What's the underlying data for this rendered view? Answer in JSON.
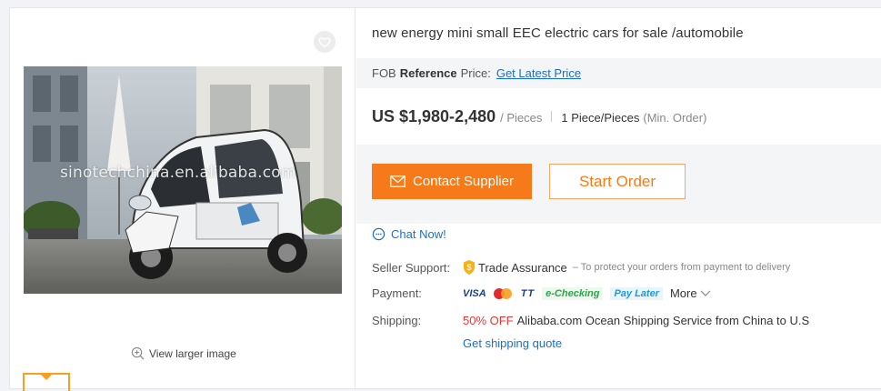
{
  "product": {
    "title": "new energy mini small EEC electric cars for sale /automobile",
    "watermark": "sinotechchina.en.alibaba.com",
    "view_larger_label": "View larger image"
  },
  "fob": {
    "prefix": "FOB",
    "bold": "Reference",
    "suffix": "Price:",
    "link": "Get Latest Price"
  },
  "price": {
    "value": "US $1,980-2,480",
    "unit": "/ Pieces",
    "moq": "1 Piece/Pieces",
    "moq_note": "(Min. Order)"
  },
  "actions": {
    "contact": "Contact Supplier",
    "start": "Start Order"
  },
  "chat": {
    "label": "Chat Now!"
  },
  "seller_support": {
    "label": "Seller Support:",
    "name": "Trade Assurance",
    "note": "– To protect your orders from payment to delivery"
  },
  "payment": {
    "label": "Payment:",
    "methods": [
      "VISA",
      "TT",
      "e-Checking",
      "Pay Later"
    ],
    "more": "More"
  },
  "shipping": {
    "label": "Shipping:",
    "discount": "50% OFF",
    "text": "Alibaba.com Ocean Shipping Service from China to U.S",
    "quote": "Get shipping quote"
  },
  "colors": {
    "accent": "#f77a1a",
    "link": "#1a6fc9",
    "discount": "#ee3333"
  }
}
